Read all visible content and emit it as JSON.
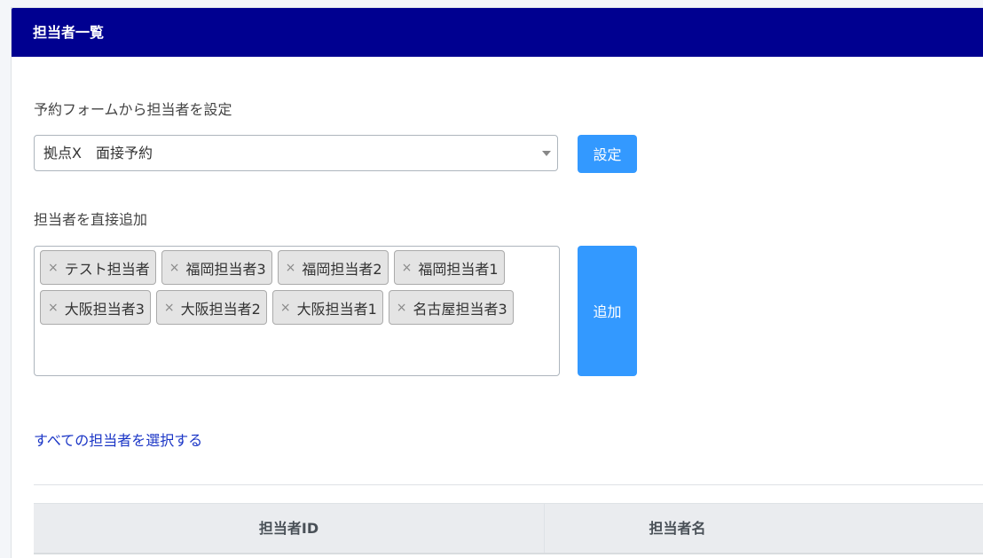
{
  "header": {
    "title": "担当者一覧"
  },
  "form_section": {
    "label": "予約フォームから担当者を設定",
    "selected_form": "拠点X　面接予約",
    "set_button": "設定"
  },
  "direct_section": {
    "label": "担当者を直接追加",
    "tag_rows": [
      [
        "テスト担当者",
        "福岡担当者3",
        "福岡担当者2",
        "福岡担当者1"
      ],
      [
        "大阪担当者3",
        "大阪担当者2",
        "大阪担当者1",
        "名古屋担当者3"
      ]
    ],
    "remove_symbol": "×",
    "add_button": "追加",
    "select_all_link": "すべての担当者を選択する"
  },
  "table": {
    "columns": [
      "担当者ID",
      "担当者名"
    ]
  }
}
